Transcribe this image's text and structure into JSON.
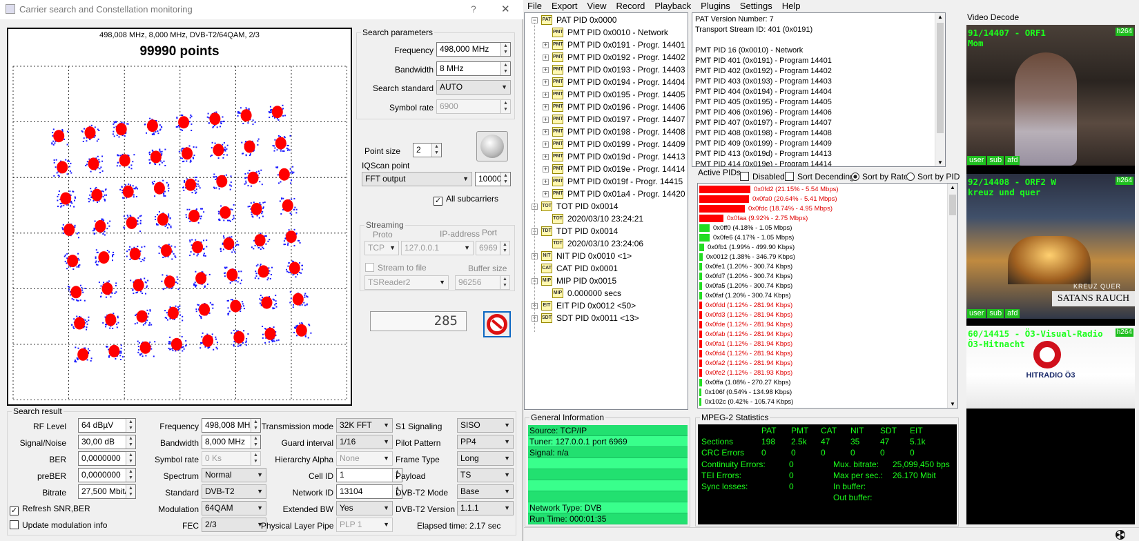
{
  "dialog": {
    "title": "Carrier search and Constellation monitoring",
    "help_label": "?",
    "close_label": "✕",
    "constellation": {
      "header": "498,008 MHz, 8,000 MHz, DVB-T2/64QAM, 2/3",
      "points": "99990 points"
    },
    "search_parameters": {
      "title": "Search parameters",
      "frequency_label": "Frequency",
      "frequency_value": "498,000 MHz",
      "bandwidth_label": "Bandwidth",
      "bandwidth_value": "8 MHz",
      "standard_label": "Search standard",
      "standard_value": "AUTO",
      "symbol_rate_label": "Symbol rate",
      "symbol_rate_value": "6900"
    },
    "point_size_label": "Point size",
    "point_size_value": "2",
    "iqscan_label": "IQScan point",
    "iqscan_value": "FFT output",
    "iqscan_count": "10000",
    "all_subcarriers_label": "All subcarriers",
    "streaming": {
      "title": "Streaming",
      "proto_label": "Proto",
      "ip_label": "IP-address",
      "port_label": "Port",
      "proto_value": "TCP",
      "ip_value": "127.0.0.1",
      "port_value": "6969",
      "stream_to_file_label": "Stream to file",
      "reader_value": "TSReader2",
      "buffer_label": "Buffer size",
      "buffer_value": "96256"
    },
    "counter": "285",
    "search_result": {
      "title": "Search result",
      "rf_level_label": "RF Level",
      "rf_level_value": "64 dBµV",
      "snr_label": "Signal/Noise",
      "snr_value": "30,00 dB",
      "ber_label": "BER",
      "ber_value": "0,0000000",
      "preber_label": "preBER",
      "preber_value": "0,0000000",
      "bitrate_label": "Bitrate",
      "bitrate_value": "27,500 Mbit/s",
      "refresh_label": "Refresh SNR,BER",
      "update_label": "Update modulation info",
      "freq_label": "Frequency",
      "freq_value": "498,008 MHz",
      "bw_label": "Bandwidth",
      "bw_value": "8,000 MHz",
      "sr_label": "Symbol rate",
      "sr_value": "0 Ks",
      "spectrum_label": "Spectrum",
      "spectrum_value": "Normal",
      "standard_label": "Standard",
      "standard_value": "DVB-T2",
      "modulation_label": "Modulation",
      "modulation_value": "64QAM",
      "fec_label": "FEC",
      "fec_value": "2/3",
      "tmode_label": "Transmission mode",
      "tmode_value": "32K FFT",
      "guard_label": "Guard interval",
      "guard_value": "1/16",
      "alpha_label": "Hierarchy Alpha",
      "alpha_value": "None",
      "cell_label": "Cell ID",
      "cell_value": "1",
      "network_label": "Network ID",
      "network_value": "13104",
      "ext_bw_label": "Extended BW",
      "ext_bw_value": "Yes",
      "plp_label": "Physical Layer Pipe",
      "plp_value": "PLP 1",
      "s1_label": "S1 Signaling",
      "s1_value": "SISO",
      "pilot_label": "Pilot Pattern",
      "pilot_value": "PP4",
      "frame_label": "Frame Type",
      "frame_value": "Long",
      "payload_label": "Payload",
      "payload_value": "TS",
      "t2mode_label": "DVB-T2 Mode",
      "t2mode_value": "Base",
      "t2ver_label": "DVB-T2 Version",
      "t2ver_value": "1.1.1",
      "elapsed": "Elapsed time: 2.17 sec"
    }
  },
  "menu": [
    "File",
    "Export",
    "View",
    "Record",
    "Playback",
    "Plugins",
    "Settings",
    "Help"
  ],
  "tree": [
    {
      "level": 0,
      "exp": "−",
      "icon": "PAT",
      "label": "PAT PID 0x0000"
    },
    {
      "level": 1,
      "exp": "",
      "icon": "PMT",
      "label": "PMT PID 0x0010 - Network"
    },
    {
      "level": 1,
      "exp": "+",
      "icon": "PMT",
      "label": "PMT PID 0x0191 - Progr. 14401"
    },
    {
      "level": 1,
      "exp": "+",
      "icon": "PMT",
      "label": "PMT PID 0x0192 - Progr. 14402"
    },
    {
      "level": 1,
      "exp": "+",
      "icon": "PMT",
      "label": "PMT PID 0x0193 - Progr. 14403"
    },
    {
      "level": 1,
      "exp": "+",
      "icon": "PMT",
      "label": "PMT PID 0x0194 - Progr. 14404"
    },
    {
      "level": 1,
      "exp": "+",
      "icon": "PMT",
      "label": "PMT PID 0x0195 - Progr. 14405"
    },
    {
      "level": 1,
      "exp": "+",
      "icon": "PMT",
      "label": "PMT PID 0x0196 - Progr. 14406"
    },
    {
      "level": 1,
      "exp": "+",
      "icon": "PMT",
      "label": "PMT PID 0x0197 - Progr. 14407"
    },
    {
      "level": 1,
      "exp": "+",
      "icon": "PMT",
      "label": "PMT PID 0x0198 - Progr. 14408"
    },
    {
      "level": 1,
      "exp": "+",
      "icon": "PMT",
      "label": "PMT PID 0x0199 - Progr. 14409"
    },
    {
      "level": 1,
      "exp": "+",
      "icon": "PMT",
      "label": "PMT PID 0x019d - Progr. 14413"
    },
    {
      "level": 1,
      "exp": "+",
      "icon": "PMT",
      "label": "PMT PID 0x019e - Progr. 14414"
    },
    {
      "level": 1,
      "exp": "+",
      "icon": "PMT",
      "label": "PMT PID 0x019f - Progr. 14415"
    },
    {
      "level": 1,
      "exp": "+",
      "icon": "PMT",
      "label": "PMT PID 0x01a4 - Progr. 14420"
    },
    {
      "level": 0,
      "exp": "−",
      "icon": "TOT",
      "label": "TOT PID 0x0014"
    },
    {
      "level": 1,
      "exp": "",
      "icon": "TOT",
      "label": "2020/03/10 23:24:21"
    },
    {
      "level": 0,
      "exp": "−",
      "icon": "TDT",
      "label": "TDT PID 0x0014"
    },
    {
      "level": 1,
      "exp": "",
      "icon": "TDT",
      "label": "2020/03/10 23:24:06"
    },
    {
      "level": 0,
      "exp": "+",
      "icon": "NIT",
      "label": "NIT PID 0x0010 <1>"
    },
    {
      "level": 0,
      "exp": "",
      "icon": "CAT",
      "label": "CAT PID 0x0001"
    },
    {
      "level": 0,
      "exp": "−",
      "icon": "MIP",
      "label": "MIP PID 0x0015"
    },
    {
      "level": 1,
      "exp": "",
      "icon": "MIP",
      "label": "0.000000 secs"
    },
    {
      "level": 0,
      "exp": "+",
      "icon": "EIT",
      "label": "EIT PID 0x0012 <50>"
    },
    {
      "level": 0,
      "exp": "+",
      "icon": "SDT",
      "label": "SDT PID 0x0011 <13>"
    }
  ],
  "pat_info": [
    "PAT Version Number: 7",
    "Transport Stream ID: 401 (0x0191)",
    "",
    "PMT PID 16 (0x0010) - Network",
    "PMT PID 401 (0x0191) - Program 14401",
    "PMT PID 402 (0x0192) - Program 14402",
    "PMT PID 403 (0x0193) - Program 14403",
    "PMT PID 404 (0x0194) - Program 14404",
    "PMT PID 405 (0x0195) - Program 14405",
    "PMT PID 406 (0x0196) - Program 14406",
    "PMT PID 407 (0x0197) - Program 14407",
    "PMT PID 408 (0x0198) - Program 14408",
    "PMT PID 409 (0x0199) - Program 14409",
    "PMT PID 413 (0x019d) - Program 14413",
    "PMT PID 414 (0x019e) - Program 14414"
  ],
  "active_pids": {
    "title": "Active PIDs",
    "disabled_label": "Disabled",
    "sort_desc_label": "Sort Decending",
    "sort_rate_label": "Sort by Rate",
    "sort_pid_label": "Sort by PID",
    "rows": [
      {
        "text": "0x0fd2 (21.15% - 5.54 Mbps)",
        "pct": 21.15,
        "color": "#ff0000"
      },
      {
        "text": "0x0fa0 (20.64% - 5.41 Mbps)",
        "pct": 20.64,
        "color": "#ff0000"
      },
      {
        "text": "0x0fdc (18.74% - 4.95 Mbps)",
        "pct": 18.74,
        "color": "#ff0000"
      },
      {
        "text": "0x0faa (9.92% - 2.75 Mbps)",
        "pct": 9.92,
        "color": "#ff0000"
      },
      {
        "text": "0x0ff0 (4.18% - 1.05 Mbps)",
        "pct": 4.18,
        "color": "#22dd22"
      },
      {
        "text": "0x0fe6 (4.17% - 1.05 Mbps)",
        "pct": 4.17,
        "color": "#22dd22"
      },
      {
        "text": "0x0fb1 (1.99% - 499.90 Kbps)",
        "pct": 1.99,
        "color": "#22dd22"
      },
      {
        "text": "0x0012 (1.38% - 346.79 Kbps)",
        "pct": 1.38,
        "color": "#22dd22"
      },
      {
        "text": "0x0fe1 (1.20% - 300.74 Kbps)",
        "pct": 1.2,
        "color": "#22dd22"
      },
      {
        "text": "0x0fd7 (1.20% - 300.74 Kbps)",
        "pct": 1.2,
        "color": "#22dd22"
      },
      {
        "text": "0x0fa5 (1.20% - 300.74 Kbps)",
        "pct": 1.2,
        "color": "#22dd22"
      },
      {
        "text": "0x0faf (1.20% - 300.74 Kbps)",
        "pct": 1.2,
        "color": "#22dd22"
      },
      {
        "text": "0x0fdd (1.12% - 281.94 Kbps)",
        "pct": 1.12,
        "color": "#ff0000"
      },
      {
        "text": "0x0fd3 (1.12% - 281.94 Kbps)",
        "pct": 1.12,
        "color": "#ff0000"
      },
      {
        "text": "0x0fde (1.12% - 281.94 Kbps)",
        "pct": 1.12,
        "color": "#ff0000"
      },
      {
        "text": "0x0fab (1.12% - 281.94 Kbps)",
        "pct": 1.12,
        "color": "#ff0000"
      },
      {
        "text": "0x0fa1 (1.12% - 281.94 Kbps)",
        "pct": 1.12,
        "color": "#ff0000"
      },
      {
        "text": "0x0fd4 (1.12% - 281.94 Kbps)",
        "pct": 1.12,
        "color": "#ff0000"
      },
      {
        "text": "0x0fa2 (1.12% - 281.94 Kbps)",
        "pct": 1.12,
        "color": "#ff0000"
      },
      {
        "text": "0x0fe2 (1.12% - 281.93 Kbps)",
        "pct": 1.12,
        "color": "#ff0000"
      },
      {
        "text": "0x0ffa (1.08% - 270.27 Kbps)",
        "pct": 1.08,
        "color": "#22dd22"
      },
      {
        "text": "0x106f (0.54% - 134.98 Kbps)",
        "pct": 0.54,
        "color": "#22dd22"
      },
      {
        "text": "0x102c (0.42% - 105.74 Kbps)",
        "pct": 0.42,
        "color": "#22dd22"
      }
    ]
  },
  "general_info": {
    "title": "General Information",
    "rows": [
      "Source: TCP/IP",
      "Tuner: 127.0.0.1 port 6969",
      "Signal: n/a",
      "",
      "",
      "",
      "",
      "Network Type: DVB",
      "Run Time: 000:01:35"
    ]
  },
  "mpeg2": {
    "title": "MPEG-2 Statistics",
    "headers": [
      "PAT",
      "PMT",
      "CAT",
      "NIT",
      "SDT",
      "EIT"
    ],
    "sections_label": "Sections",
    "sections": [
      "198",
      "2.5k",
      "47",
      "35",
      "47",
      "5.1k"
    ],
    "crc_label": "CRC Errors",
    "crc": [
      "0",
      "0",
      "0",
      "0",
      "0",
      "0"
    ],
    "continuity_label": "Continuity Errors:",
    "continuity_value": "0",
    "tei_label": "TEI Errors:",
    "tei_value": "0",
    "sync_label": "Sync losses:",
    "sync_value": "0",
    "mux_label": "Mux. bitrate:",
    "mux_value": "25,099,450 bps",
    "max_label": "Max per sec.:",
    "max_value": "26.170 Mbit",
    "inbuf_label": "In buffer:",
    "outbuf_label": "Out buffer:"
  },
  "video": {
    "title": "Video Decode",
    "tiles": [
      {
        "line1": "91/14407 - ORF1",
        "line2": "Mom",
        "badge": "h264",
        "tags": [
          "user",
          "sub",
          "afd"
        ]
      },
      {
        "line1": "92/14408 - ORF2 W",
        "line2": "kreuz und quer",
        "badge": "h264",
        "tags": [
          "user",
          "sub",
          "afd"
        ],
        "overlay1": "KREUZ QUER",
        "overlay2": "SATANS RAUCH"
      },
      {
        "line1": "60/14415 - Ö3-Visual-Radio",
        "line2": "Ö3-Hitnacht",
        "badge": "h264",
        "tags": [],
        "logo": "HITRADIO Ö3"
      }
    ]
  },
  "colors": {
    "accent_green": "#1cff1c",
    "stats_bg": "#000000",
    "info_green": "#33ff88",
    "pid_red": "#ff0000",
    "pid_green": "#22dd22"
  }
}
